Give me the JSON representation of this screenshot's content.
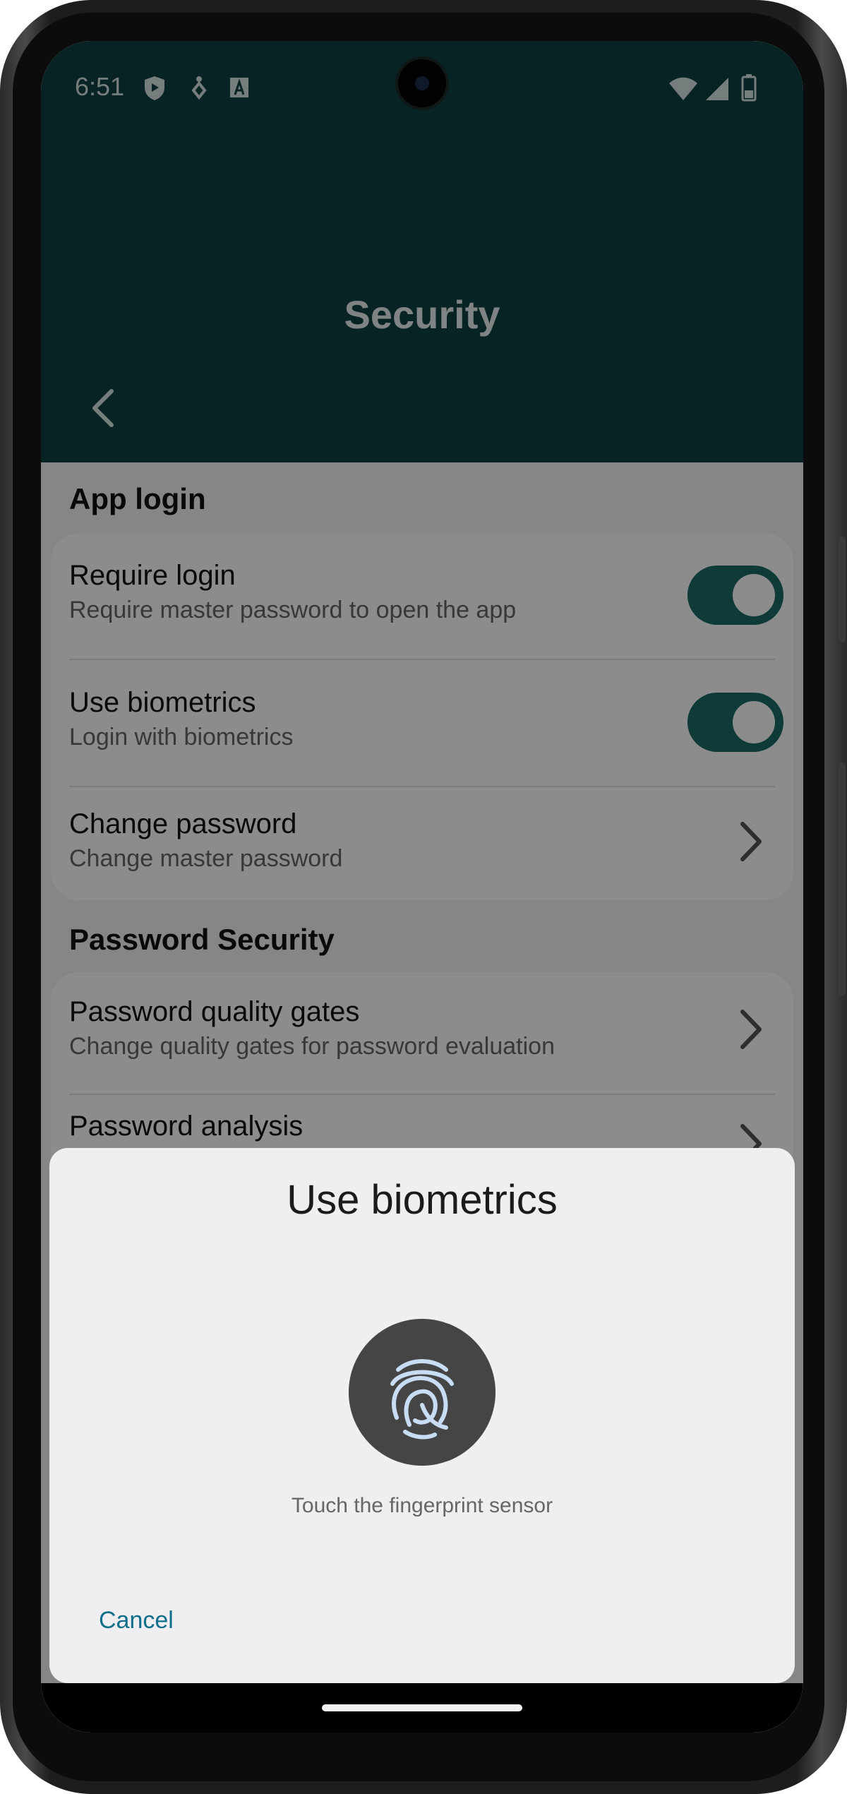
{
  "status_bar": {
    "time": "6:51"
  },
  "header": {
    "title": "Security"
  },
  "sections": {
    "app_login": {
      "title": "App login",
      "require_login": {
        "title": "Require login",
        "subtitle": "Require master password to open the app",
        "enabled": true
      },
      "use_biometrics": {
        "title": "Use biometrics",
        "subtitle": "Login with biometrics",
        "enabled": true
      },
      "change_password": {
        "title": "Change password",
        "subtitle": "Change master password"
      }
    },
    "password_security": {
      "title": "Password Security",
      "quality_gates": {
        "title": "Password quality gates",
        "subtitle": "Change quality gates for password evaluation"
      },
      "analysis": {
        "title": "Password analysis"
      }
    }
  },
  "dialog": {
    "title": "Use biometrics",
    "hint": "Touch the fingerprint sensor",
    "cancel_label": "Cancel"
  },
  "colors": {
    "header_bg": "#0f4140",
    "toggle_on": "#1a6a67",
    "accent_link": "#0f6f8a"
  },
  "icons": {
    "back": "chevron-left-icon",
    "row_chevron": "chevron-right-icon",
    "fingerprint": "fingerprint-icon",
    "shield": "shield-icon",
    "wifi": "wifi-icon",
    "signal": "signal-icon",
    "battery": "battery-icon"
  }
}
